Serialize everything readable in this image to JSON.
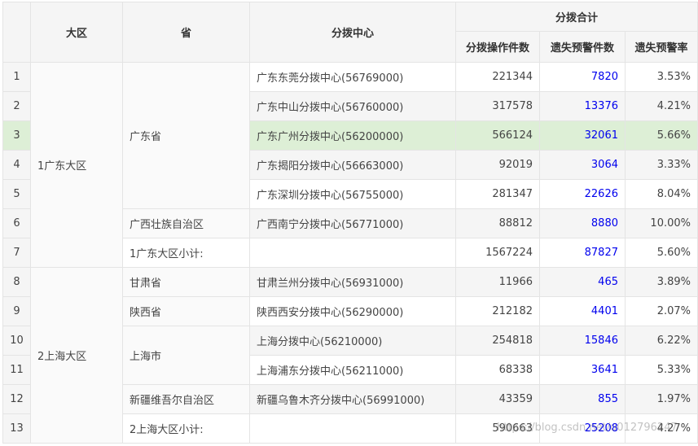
{
  "headers": {
    "region": "大区",
    "province": "省",
    "center": "分拨中心",
    "group": "分拨合计",
    "ops": "分拨操作件数",
    "loss_count": "遗失预警件数",
    "loss_rate": "遗失预警率"
  },
  "regions": [
    {
      "name": "1广东大区",
      "provinces": [
        {
          "name": "广东省",
          "rows": [
            {
              "idx": "1",
              "center": "广东东莞分拨中心(56769000)",
              "ops": "221344",
              "loss": "7820",
              "rate": "3.53%"
            },
            {
              "idx": "2",
              "center": "广东中山分拨中心(56760000)",
              "ops": "317578",
              "loss": "13376",
              "rate": "4.21%"
            },
            {
              "idx": "3",
              "center": "广东广州分拨中心(56200000)",
              "ops": "566124",
              "loss": "32061",
              "rate": "5.66%"
            },
            {
              "idx": "4",
              "center": "广东揭阳分拨中心(56663000)",
              "ops": "92019",
              "loss": "3064",
              "rate": "3.33%"
            },
            {
              "idx": "5",
              "center": "广东深圳分拨中心(56755000)",
              "ops": "281347",
              "loss": "22626",
              "rate": "8.04%"
            }
          ]
        },
        {
          "name": "广西壮族自治区",
          "rows": [
            {
              "idx": "6",
              "center": "广西南宁分拨中心(56771000)",
              "ops": "88812",
              "loss": "8880",
              "rate": "10.00%"
            }
          ]
        }
      ],
      "subtotal": {
        "idx": "7",
        "label": "1广东大区小计:",
        "ops": "1567224",
        "loss": "87827",
        "rate": "5.60%"
      }
    },
    {
      "name": "2上海大区",
      "provinces": [
        {
          "name": "甘肃省",
          "rows": [
            {
              "idx": "8",
              "center": "甘肃兰州分拨中心(56931000)",
              "ops": "11966",
              "loss": "465",
              "rate": "3.89%"
            }
          ]
        },
        {
          "name": "陕西省",
          "rows": [
            {
              "idx": "9",
              "center": "陕西西安分拨中心(56290000)",
              "ops": "212182",
              "loss": "4401",
              "rate": "2.07%"
            }
          ]
        },
        {
          "name": "上海市",
          "rows": [
            {
              "idx": "10",
              "center": "上海分拨中心(56210000)",
              "ops": "254818",
              "loss": "15846",
              "rate": "6.22%"
            },
            {
              "idx": "11",
              "center": "上海浦东分拨中心(56211000)",
              "ops": "68338",
              "loss": "3641",
              "rate": "5.33%"
            }
          ]
        },
        {
          "name": "新疆维吾尔自治区",
          "rows": [
            {
              "idx": "12",
              "center": "新疆乌鲁木齐分拨中心(56991000)",
              "ops": "43359",
              "loss": "855",
              "rate": "1.97%"
            }
          ]
        }
      ],
      "subtotal": {
        "idx": "13",
        "label": "2上海大区小计:",
        "ops": "590663",
        "loss": "25208",
        "rate": "4.27%"
      }
    }
  ],
  "highlight_row": "3",
  "watermark": "https://blog.csdn.net/u012796247"
}
